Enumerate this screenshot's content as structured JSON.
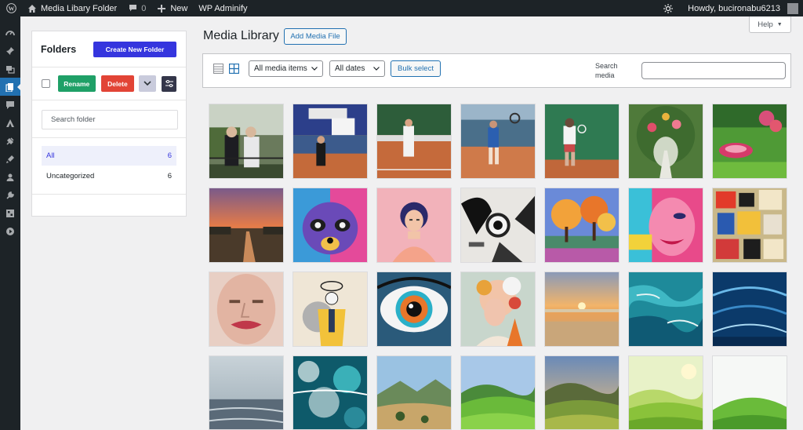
{
  "admin_bar": {
    "site_name": "Media Libary Folder",
    "comments_count": "0",
    "new_label": "New",
    "plugin_label": "WP Adminify",
    "greeting": "Howdy, bucironabu6213"
  },
  "side_menu": {
    "items": [
      "dashboard-icon",
      "pin-icon",
      "media-icon",
      "pages-icon",
      "comments-icon",
      "appearance-icon",
      "plugins-icon",
      "brush-icon",
      "users-icon",
      "tools-icon",
      "settings-icon",
      "play-icon"
    ],
    "current": "pages-icon"
  },
  "folders": {
    "title": "Folders",
    "create_label": "Create New Folder",
    "rename_label": "Rename",
    "delete_label": "Delete",
    "search_placeholder": "Search folder",
    "items": [
      {
        "label": "All",
        "count": "6"
      },
      {
        "label": "Uncategorized",
        "count": "6"
      }
    ],
    "colors": {
      "primary": "#3535de",
      "rename": "#1fa067",
      "delete": "#e24436"
    }
  },
  "main": {
    "title": "Media Library",
    "add_media_label": "Add Media File",
    "help_label": "Help",
    "filter_type": "All media items",
    "filter_date": "All dates",
    "bulk_select_label": "Bulk select",
    "search_label": "Search media"
  },
  "media_items": [
    {
      "subject": "tennis-players-net"
    },
    {
      "subject": "tennis-court-umbrella"
    },
    {
      "subject": "tennis-clay-court"
    },
    {
      "subject": "tennis-player-jump"
    },
    {
      "subject": "tennis-player-forehand"
    },
    {
      "subject": "garden-arch-path"
    },
    {
      "subject": "garden-flower-lawn"
    },
    {
      "subject": "sunset-field-path"
    },
    {
      "subject": "colorful-raccoon"
    },
    {
      "subject": "pink-girl-portrait"
    },
    {
      "subject": "abstract-ink-eye"
    },
    {
      "subject": "colorful-trees"
    },
    {
      "subject": "pop-art-face"
    },
    {
      "subject": "collage-letters"
    },
    {
      "subject": "painted-face-lips"
    },
    {
      "subject": "yellow-suit-figure"
    },
    {
      "subject": "colorful-eye"
    },
    {
      "subject": "floral-woman"
    },
    {
      "subject": "beach-sunset"
    },
    {
      "subject": "ocean-waves-aerial"
    },
    {
      "subject": "deep-blue-waves"
    },
    {
      "subject": "foggy-sea"
    },
    {
      "subject": "ocean-foam"
    },
    {
      "subject": "mountain-valley"
    },
    {
      "subject": "green-hills"
    },
    {
      "subject": "hills-sunset"
    },
    {
      "subject": "bright-green-hills"
    },
    {
      "subject": "green-hill-white-sky"
    }
  ]
}
